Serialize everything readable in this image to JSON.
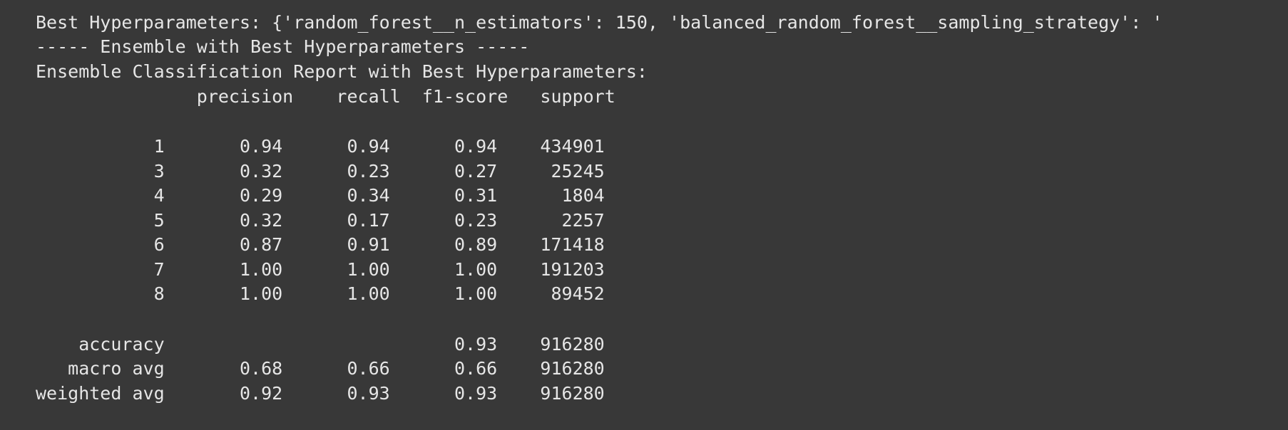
{
  "output": {
    "best_params_line": "Best Hyperparameters: {'random_forest__n_estimators': 150, 'balanced_random_forest__sampling_strategy': '",
    "ensemble_header": "----- Ensemble with Best Hyperparameters -----",
    "report_title": "Ensemble Classification Report with Best Hyperparameters:",
    "header_row": "               precision    recall  f1-score   support",
    "class_rows": [
      "           1       0.94      0.94      0.94    434901",
      "           3       0.32      0.23      0.27     25245",
      "           4       0.29      0.34      0.31      1804",
      "           5       0.32      0.17      0.23      2257",
      "           6       0.87      0.91      0.89    171418",
      "           7       1.00      1.00      1.00    191203",
      "           8       1.00      1.00      1.00     89452"
    ],
    "summary_rows": [
      "    accuracy                           0.93    916280",
      "   macro avg       0.68      0.66      0.66    916280",
      "weighted avg       0.92      0.93      0.93    916280"
    ]
  }
}
